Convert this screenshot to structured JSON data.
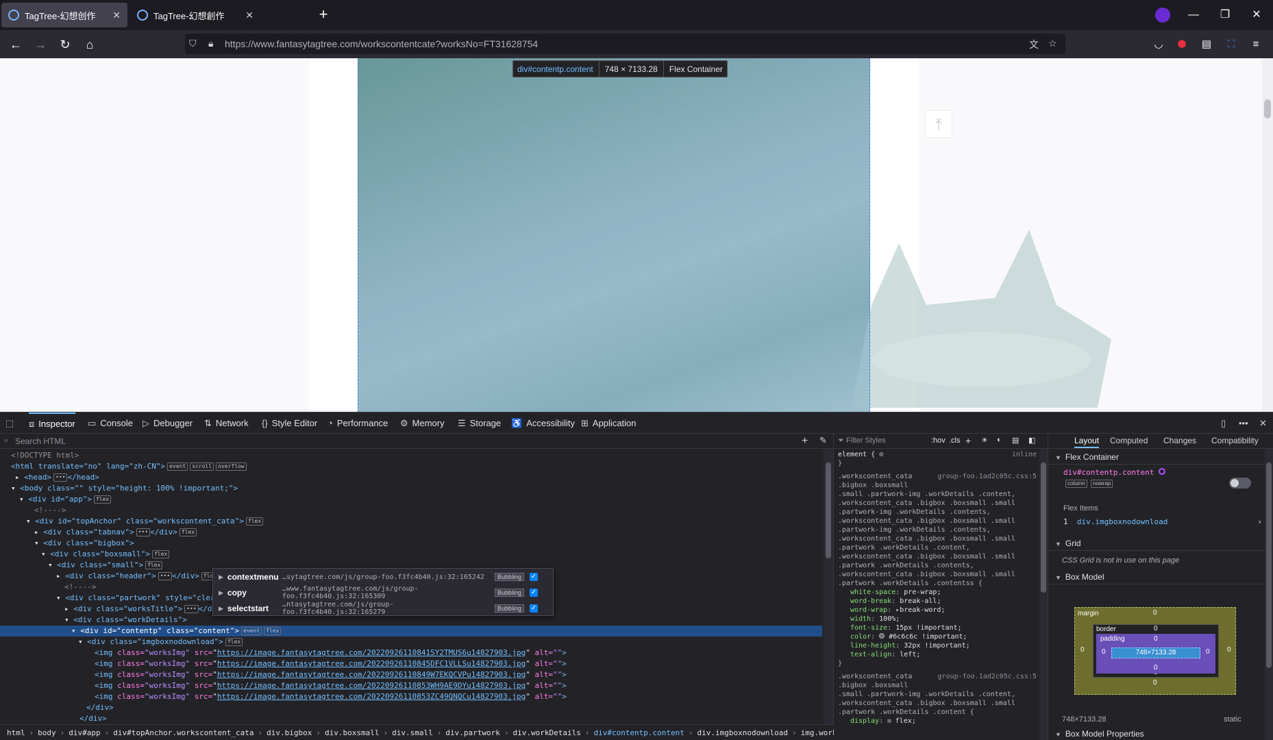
{
  "browser": {
    "tabs": [
      {
        "title": "TagTree-幻想创作",
        "active": true
      },
      {
        "title": "TagTree-幻想創作",
        "active": false
      }
    ],
    "new_tab_label": "+",
    "url": "https://www.fantasytagtree.com/workscontentcate?worksNo=FT31628754",
    "window_controls": {
      "minimize": "—",
      "restore": "❐",
      "close": "✕"
    }
  },
  "page": {
    "highlight": {
      "selector": "div#contentp.content",
      "size": "748 × 7133.28",
      "type": "Flex Container"
    },
    "scroll_top_icon": "arrow-up-to-line-icon"
  },
  "devtools": {
    "tabs": [
      {
        "label": "Inspector",
        "icon": "inspector-icon",
        "active": true
      },
      {
        "label": "Console",
        "icon": "console-icon"
      },
      {
        "label": "Debugger",
        "icon": "debugger-icon"
      },
      {
        "label": "Network",
        "icon": "network-icon"
      },
      {
        "label": "Style Editor",
        "icon": "braces-icon"
      },
      {
        "label": "Performance",
        "icon": "gauge-icon"
      },
      {
        "label": "Memory",
        "icon": "memory-icon"
      },
      {
        "label": "Storage",
        "icon": "storage-icon"
      },
      {
        "label": "Accessibility",
        "icon": "accessibility-icon"
      },
      {
        "label": "Application",
        "icon": "grid-icon"
      }
    ],
    "search_html_placeholder": "Search HTML",
    "markup": {
      "doctype": "<!DOCTYPE html>",
      "html_open": "<html translate=\"no\" lang=\"zh-CN\">",
      "head": "<head>",
      "head_close": "</head>",
      "body_open": "<body class=\"\" style=\"height: 100% !important;\">",
      "app": "<div id=\"app\">",
      "comment1": "<!---->",
      "topanchor": "<div id=\"topAnchor\" class=\"workscontent_cata\">",
      "tabnav": "<div class=\"tabnav\">",
      "tabnav_close": "</div>",
      "bigbox": "<div class=\"bigbox\">",
      "boxsmall": "<div class=\"boxsmall\">",
      "small": "<div class=\"small\">",
      "header": "<div class=\"header\">",
      "header_close": "</div>",
      "comment2": "<!---->",
      "partwork": "<div class=\"partwork\" style=\"clear:",
      "workstitle": "<div class=\"worksTitle\">",
      "workstitle_close": "</div>",
      "workdetails": "<div class=\"workDetails\">",
      "contentp": "<div id=\"contentp\" class=\"content\">",
      "imgbox": "<div class=\"imgboxnodownload\">",
      "images": [
        "https://image.fantasytagtree.com/20220926110841SY2TMUS6u14827903.jpg",
        "https://image.fantasytagtree.com/20220926110845DFC1VLLSu14827903.jpg",
        "https://image.fantasytagtree.com/20220926110849W7EKQCVPu14827903.jpg",
        "https://image.fantasytagtree.com/20220926110853WH9AE9DYu14827903.jpg",
        "https://image.fantasytagtree.com/20220926110853ZC49QNQCu14827903.jpg"
      ],
      "div_close": "</div>",
      "badges": {
        "event": "event",
        "scroll": "scroll",
        "overflow": "overflow",
        "flex": "flex",
        "dots": "•••"
      }
    },
    "event_popup": [
      {
        "name": "contextmenu",
        "source": "…sytagtree.com/js/group-foo.f3fc4b40.js:32:165242",
        "phase": "Bubbling"
      },
      {
        "name": "copy",
        "source": "…www.fantasytagtree.com/js/group-foo.f3fc4b40.js:32:165309",
        "phase": "Bubbling"
      },
      {
        "name": "selectstart",
        "source": "…ntasytagtree.com/js/group-foo.f3fc4b40.js:32:165279",
        "phase": "Bubbling"
      }
    ],
    "breadcrumbs": [
      "html",
      "body",
      "div#app",
      "div#topAnchor.workscontent_cata",
      "div.bigbox",
      "div.boxsmall",
      "div.small",
      "div.partwork",
      "div.workDetails",
      "div#contentp.content",
      "div.imgboxnodownload",
      "img.worksImg"
    ],
    "rules": {
      "filter_placeholder": "Filter Styles",
      "hov": ":hov",
      "cls": ".cls",
      "element_rule": "element {",
      "inline": "inline",
      "close_brace": "}",
      "rule1_source": "group-foo.1ad2c05c.css:5",
      "rule1_selectors": [
        ".workscontent_cata",
        ".bigbox .boxsmall",
        ".small .partwork-img .workDetails .content,",
        ".workscontent_cata .bigbox .boxsmall .small",
        ".partwork-img .workDetails .contents,",
        ".workscontent_cata .bigbox .boxsmall .small",
        ".partwork-img .workDetails .contents,",
        ".workscontent_cata .bigbox .boxsmall .small",
        ".partwork .workDetails .content,",
        ".workscontent_cata .bigbox .boxsmall .small",
        ".partwork .workDetails .contents,",
        ".workscontent_cata .bigbox .boxsmall .small",
        ".partwork .workDetails .contentss {"
      ],
      "rule1_props": [
        {
          "p": "white-space",
          "v": "pre-wrap;"
        },
        {
          "p": "word-break",
          "v": "break-all;"
        },
        {
          "p": "word-wrap",
          "v": "break-word;"
        },
        {
          "p": "width",
          "v": "100%;"
        },
        {
          "p": "font-size",
          "v": "15px !important;"
        },
        {
          "p": "color",
          "v": "#6c6c6c !important;"
        },
        {
          "p": "line-height",
          "v": "32px !important;"
        },
        {
          "p": "text-align",
          "v": "left;"
        }
      ],
      "rule2_source": "group-foo.1ad2c05c.css:5",
      "rule2_selectors": [
        ".workscontent_cata",
        ".bigbox .boxsmall",
        ".small .partwork-img .workDetails .content,",
        ".workscontent_cata .bigbox .boxsmall .small",
        ".partwork .workDetails .content {"
      ],
      "rule2_props": [
        {
          "p": "display",
          "v": "flex;"
        }
      ]
    },
    "layout": {
      "tabs": [
        "Layout",
        "Computed",
        "Changes",
        "Compatibility"
      ],
      "flex_container_title": "Flex Container",
      "flex_selector": "div#contentp.content",
      "flex_badges": [
        "column",
        "nowrap"
      ],
      "flex_items_title": "Flex Items",
      "flex_item_index": "1",
      "flex_item": "div.imgboxnodownload",
      "grid_title": "Grid",
      "grid_message": "CSS Grid is not in use on this page",
      "box_model_title": "Box Model",
      "box_labels": {
        "margin": "margin",
        "border": "border",
        "padding": "padding"
      },
      "content_size": "748×7133.28",
      "zero": "0",
      "size_readout": "748×7133.28",
      "position": "static",
      "box_model_props_title": "Box Model Properties"
    }
  }
}
